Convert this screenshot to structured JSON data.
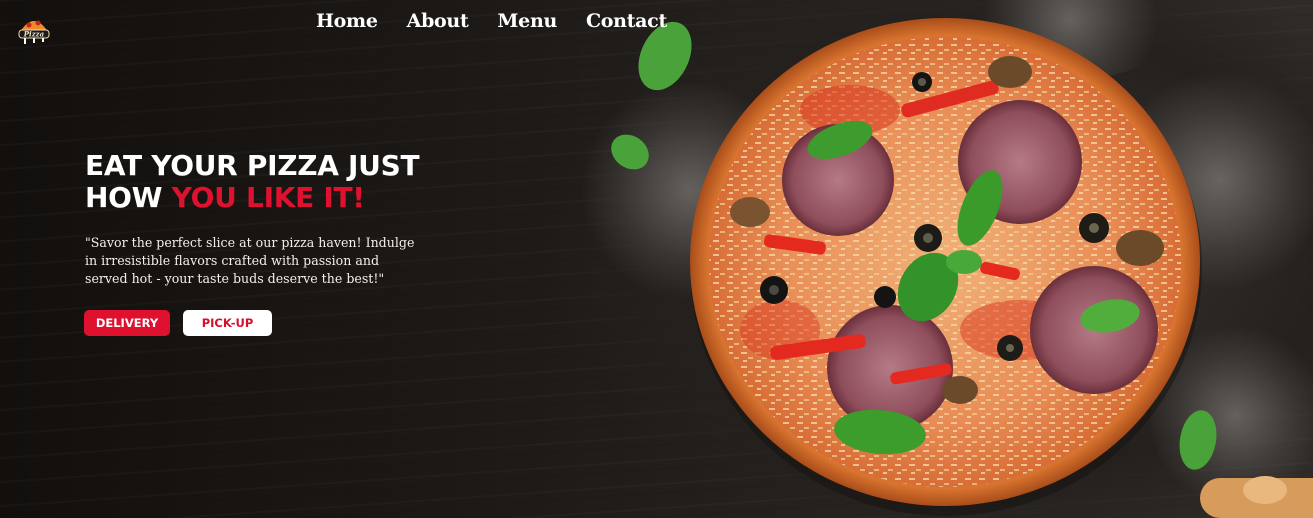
{
  "brand": {
    "logo_text": "Pizza",
    "logo_icon": "pizza-logo-icon"
  },
  "nav": {
    "items": [
      "Home",
      "About",
      "Menu",
      "Contact"
    ]
  },
  "hero": {
    "headline_line1": "EAT YOUR PIZZA JUST",
    "headline_line2_prefix": "HOW ",
    "headline_accent": "YOU LIKE IT!",
    "tagline": "\"Savor the perfect slice at our pizza haven! Indulge in irresistible flavors crafted with passion and served hot - your taste buds deserve the best!\"",
    "buttons": {
      "delivery": "DELIVERY",
      "pickup": "PICK-UP"
    }
  },
  "colors": {
    "accent": "#e0102f",
    "text": "#ffffff",
    "background": "#1a1613"
  }
}
